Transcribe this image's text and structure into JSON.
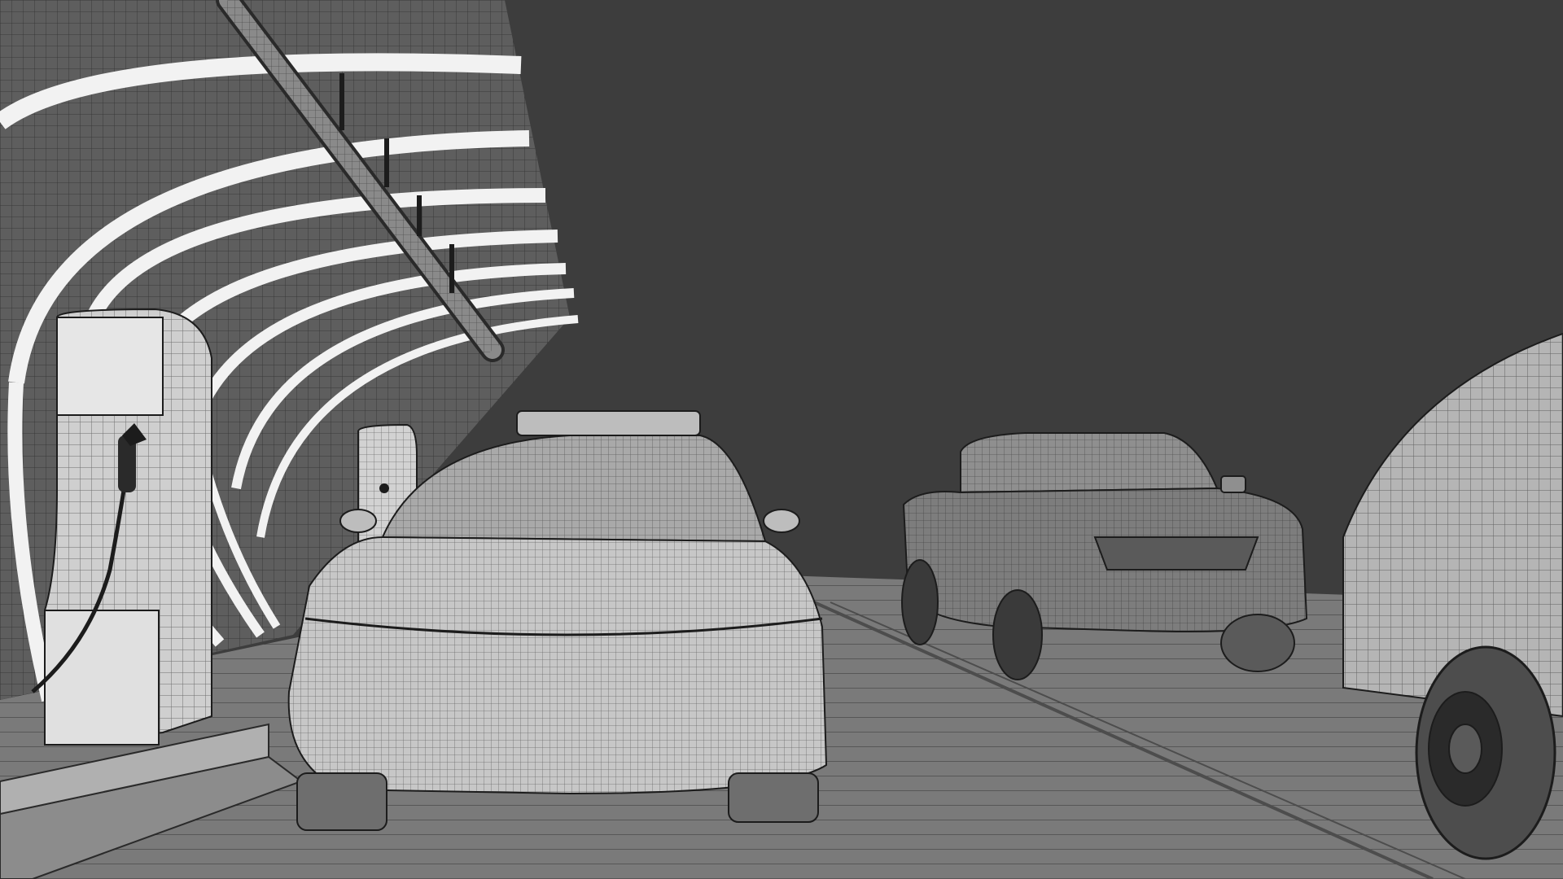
{
  "colors": {
    "background": "#3d3d3d",
    "surface_light": "#d9d9d9",
    "surface_mid": "#a6a6a6",
    "surface_dark": "#6e6e6e",
    "wire": "#1c1c1c",
    "highlight": "#f4f4f4"
  },
  "icons": [
    "charging-station-icon",
    "charging-cable-icon",
    "car-icon",
    "pickup-truck-icon",
    "trailer-icon",
    "pipe-icon"
  ]
}
